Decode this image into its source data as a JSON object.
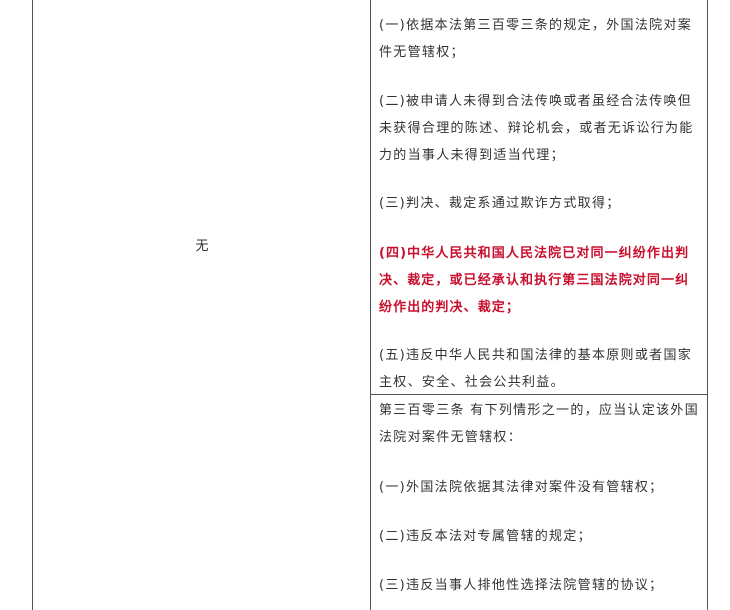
{
  "left_cell": {
    "text": "无"
  },
  "cell_a": {
    "paragraphs": [
      "(一)依据本法第三百零三条的规定，外国法院对案件无管辖权；",
      "(二)被申请人未得到合法传唤或者虽经合法传唤但未获得合理的陈述、辩论机会，或者无诉讼行为能力的当事人未得到适当代理；",
      "(三)判决、裁定系通过欺诈方式取得；",
      "(四)中华人民共和国人民法院已对同一纠纷作出判决、裁定，或已经承认和执行第三国法院对同一纠纷作出的判决、裁定；",
      "(五)违反中华人民共和国法律的基本原则或者国家主权、安全、社会公共利益。"
    ],
    "highlight_color": "#c8102e"
  },
  "cell_b": {
    "paragraphs": [
      "第三百零三条  有下列情形之一的，应当认定该外国法院对案件无管辖权：",
      "(一)外国法院依据其法律对案件没有管辖权；",
      "(二)违反本法对专属管辖的规定；",
      "(三)违反当事人排他性选择法院管辖的协议；"
    ]
  }
}
